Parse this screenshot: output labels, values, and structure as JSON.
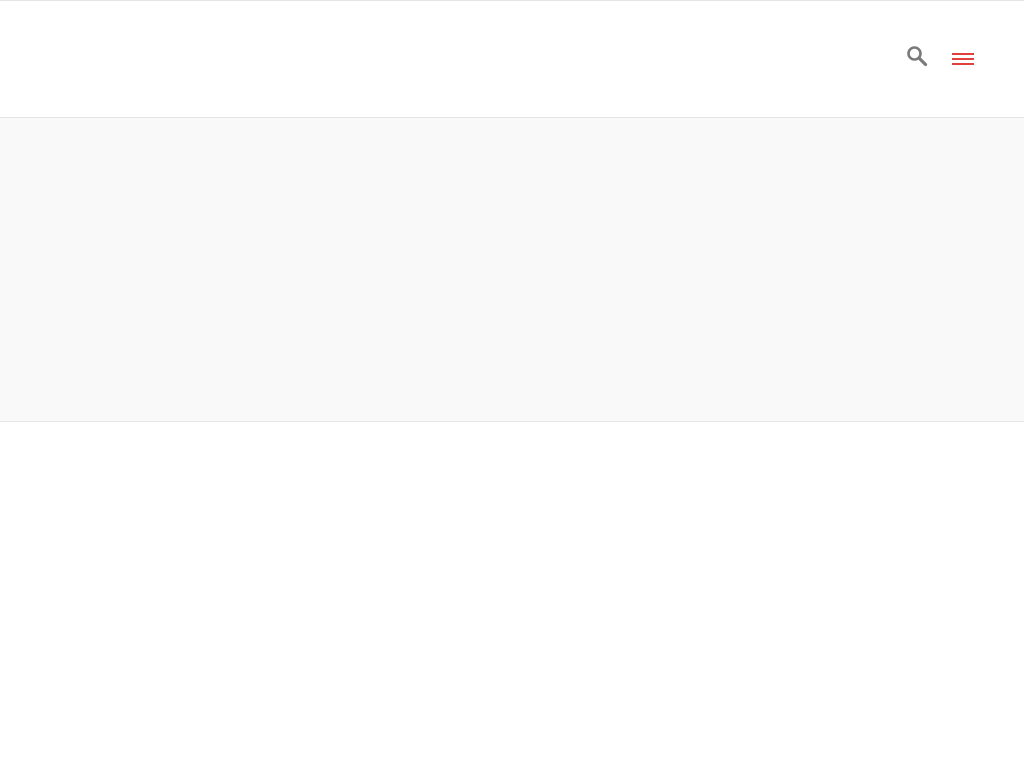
{
  "header": {
    "search_icon": "search-icon",
    "menu_icon": "hamburger-menu-icon"
  },
  "colors": {
    "search_icon": "#7a7a7a",
    "menu_icon": "#e0413a",
    "hero_background": "#f9f9f9",
    "divider": "#e4e4e4"
  }
}
